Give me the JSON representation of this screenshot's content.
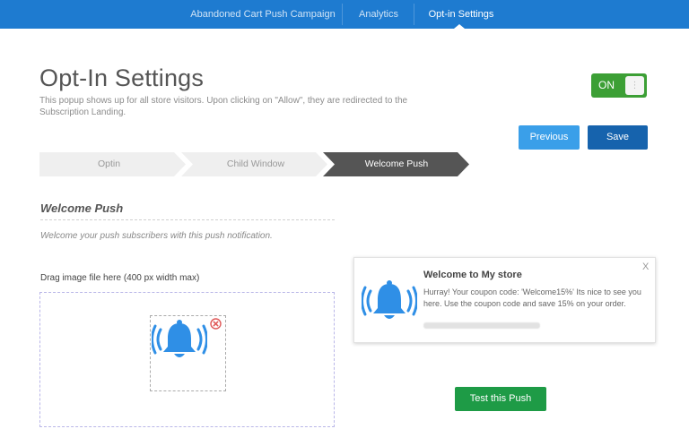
{
  "nav": {
    "tabs": [
      {
        "label": "Abandoned Cart Push Campaign"
      },
      {
        "label": "Analytics"
      },
      {
        "label": "Opt-in Settings",
        "active": true
      }
    ]
  },
  "header": {
    "title": "Opt-In Settings",
    "description": "This popup shows up for all store visitors. Upon clicking on \"Allow\", they are redirected to the Subscription Landing."
  },
  "toggle": {
    "label": "ON",
    "state": "on",
    "color": "#3c9f35"
  },
  "actions": {
    "previous_label": "Previous",
    "save_label": "Save"
  },
  "steps": [
    {
      "label": "Optin",
      "active": false
    },
    {
      "label": "Child Window",
      "active": false
    },
    {
      "label": "Welcome Push",
      "active": true
    }
  ],
  "section": {
    "title": "Welcome Push",
    "subtitle": "Welcome your push subscribers with this push notification."
  },
  "upload": {
    "label": "Drag image file here (400 px width max)"
  },
  "notification": {
    "title": "Welcome to My store",
    "body": "Hurray! Your coupon code: 'Welcome15%' Its nice to see you here. Use the coupon code and save 15% on your order.",
    "close_label": "X"
  },
  "test_button_label": "Test this Push",
  "colors": {
    "nav_bg": "#1e7bd0",
    "primary": "#3a9fe9",
    "save": "#1663ad",
    "test": "#1e9b46",
    "bell": "#2f8fe6"
  }
}
